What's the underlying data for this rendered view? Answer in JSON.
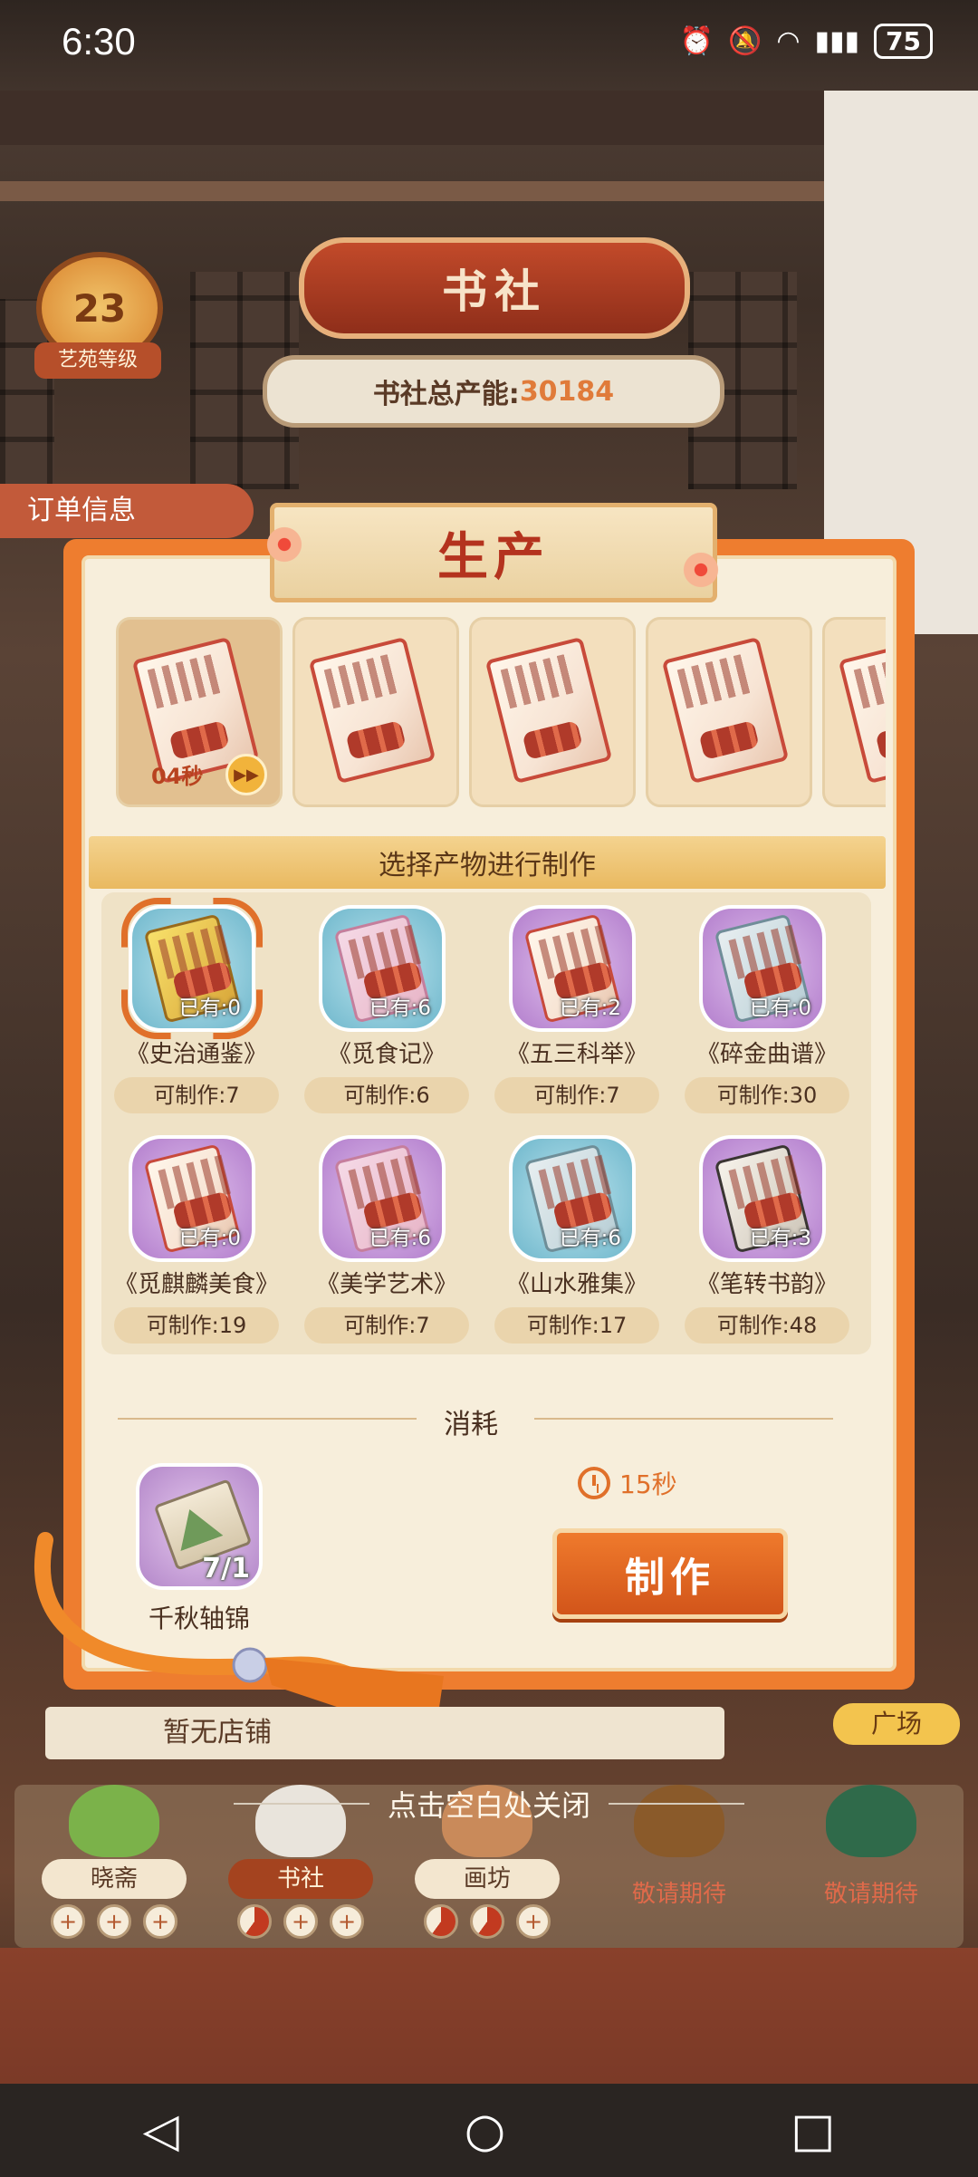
{
  "status_bar": {
    "time": "6:30",
    "battery": "75",
    "icons": [
      "alarm-icon",
      "bell-off-icon",
      "wifi-icon",
      "signal-4g-icon",
      "battery-icon"
    ]
  },
  "header": {
    "club_title": "书社",
    "capacity_label": "书社总产能:",
    "capacity_value": "30184",
    "level": "23",
    "level_label": "艺苑等级",
    "order_tab": "订单信息"
  },
  "panel": {
    "title": "生产",
    "queue": [
      {
        "timer": "04秒",
        "active": true
      },
      {
        "timer": "",
        "active": false
      },
      {
        "timer": "",
        "active": false
      },
      {
        "timer": "",
        "active": false
      },
      {
        "timer": "",
        "active": false
      }
    ],
    "select_banner": "选择产物进行制作",
    "products": [
      {
        "name": "《史治通鉴》",
        "owned": "已有:0",
        "makeable": "可制作:7",
        "theme": "blue",
        "selected": true
      },
      {
        "name": "《觅食记》",
        "owned": "已有:6",
        "makeable": "可制作:6",
        "theme": "blue",
        "selected": false
      },
      {
        "name": "《五三科举》",
        "owned": "已有:2",
        "makeable": "可制作:7",
        "theme": "purple",
        "selected": false
      },
      {
        "name": "《碎金曲谱》",
        "owned": "已有:0",
        "makeable": "可制作:30",
        "theme": "purple",
        "selected": false
      },
      {
        "name": "《觅麒麟美食》",
        "owned": "已有:0",
        "makeable": "可制作:19",
        "theme": "purple",
        "selected": false
      },
      {
        "name": "《美学艺术》",
        "owned": "已有:6",
        "makeable": "可制作:7",
        "theme": "purple",
        "selected": false
      },
      {
        "name": "《山水雅集》",
        "owned": "已有:6",
        "makeable": "可制作:17",
        "theme": "blue",
        "selected": false
      },
      {
        "name": "《笔转书韵》",
        "owned": "已有:3",
        "makeable": "可制作:48",
        "theme": "purple",
        "selected": false
      }
    ],
    "consume_label": "消耗",
    "material": {
      "name": "千秋轴锦",
      "count": "7/1"
    },
    "duration": "15秒",
    "make_button": "制作"
  },
  "bottom": {
    "no_shop": "暂无店铺",
    "square_tag": "广场",
    "close_hint": "点击空白处关闭",
    "buildings": [
      {
        "name": "晓斋",
        "selected": false,
        "slots": [
          "+",
          "+",
          "+"
        ],
        "busy": []
      },
      {
        "name": "书社",
        "selected": true,
        "slots": [
          "",
          "+",
          "+"
        ],
        "busy": [
          0
        ]
      },
      {
        "name": "画坊",
        "selected": false,
        "slots": [
          "",
          "",
          "+"
        ],
        "busy": [
          0,
          1
        ]
      },
      {
        "name": "敬请期待",
        "soon": true
      },
      {
        "name": "敬请期待",
        "soon": true
      }
    ]
  },
  "navbar": {
    "back": "◁",
    "home": "○",
    "recents": "□"
  },
  "colors": {
    "accent": "#ee7d2f",
    "title_red": "#b4331e",
    "panel_bg": "#f7eedb",
    "gold": "#e9b960"
  }
}
